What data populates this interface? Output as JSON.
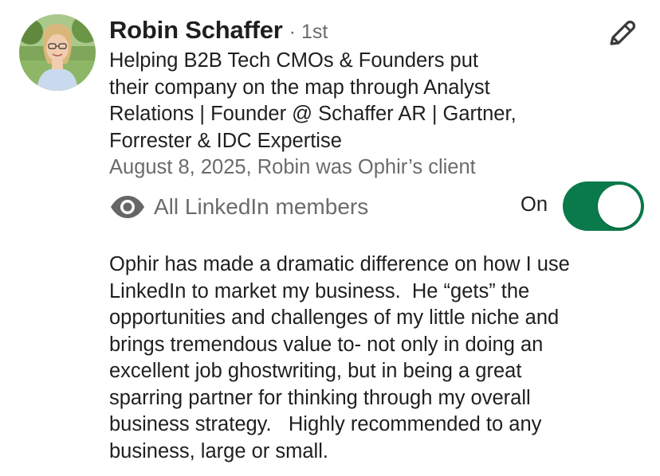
{
  "recommendation": {
    "author_name": "Robin Schaffer",
    "connection_degree": "· 1st",
    "headline_lines": [
      "Helping B2B Tech CMOs & Founders put",
      "their company on the map through Analyst",
      "Relations | Founder @ Schaffer AR | Gartner,",
      "Forrester & IDC Expertise"
    ],
    "meta": "August 8, 2025, Robin was Ophir’s client",
    "visibility": {
      "label": "All LinkedIn members",
      "icon": "eye-icon"
    },
    "toggle": {
      "label": "On",
      "state": "on",
      "color": "#0b7a4b"
    },
    "edit_icon": "pencil-icon",
    "body_lines": [
      "Ophir has made a dramatic difference on how I use",
      "LinkedIn to market my business.  He “gets” the",
      "opportunities and challenges of my little niche and",
      "brings tremendous value to- not only in doing an",
      "excellent job ghostwriting, but in being a great",
      "sparring partner for thinking through my overall",
      "business strategy.   Highly recommended to any",
      "business, large or small."
    ]
  }
}
